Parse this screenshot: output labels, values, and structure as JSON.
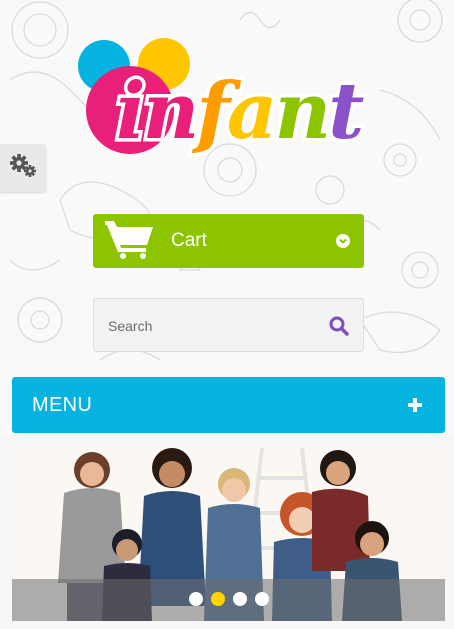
{
  "logo": {
    "text": "infant",
    "letters": [
      "i",
      "n",
      "f",
      "a",
      "n",
      "t"
    ],
    "colors": [
      "#e8207a",
      "#e8207a",
      "#ff9c00",
      "#ffc600",
      "#8cc500",
      "#8b52c9"
    ]
  },
  "settings": {
    "icon": "gears-icon"
  },
  "cart": {
    "label": "Cart",
    "icon": "shopping-cart-icon",
    "caret_icon": "chevron-down-circle-icon",
    "bg": "#8cc500"
  },
  "search": {
    "placeholder": "Search",
    "value": "",
    "icon": "search-icon",
    "icon_color": "#7b4fc3"
  },
  "menu": {
    "label": "MENU",
    "icon": "plus-icon",
    "bg": "#06b2e0"
  },
  "slider": {
    "slide_count": 4,
    "active_index": 1,
    "active_color": "#ffd500"
  }
}
